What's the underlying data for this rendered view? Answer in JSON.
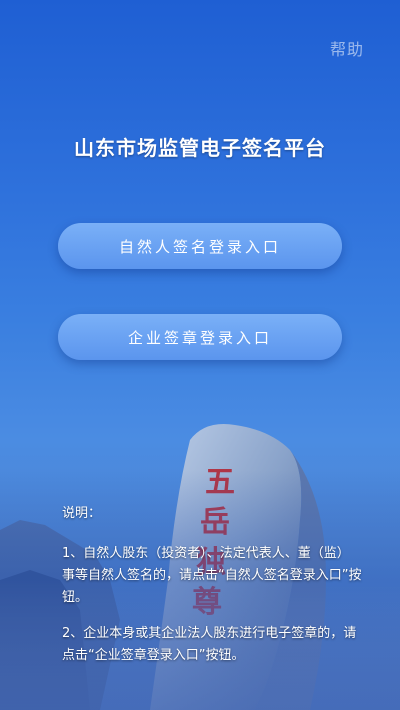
{
  "header": {
    "help_label": "帮助"
  },
  "main": {
    "title": "山东市场监管电子签名平台",
    "buttons": [
      {
        "label": "自然人签名登录入口"
      },
      {
        "label": "企业签章登录入口"
      }
    ]
  },
  "notes": {
    "heading": "说明：",
    "items": [
      "1、自然人股东（投资者）、法定代表人、董（监）事等自然人签名的，请点击“自然人签名登录入口”按钮。",
      "2、企业本身或其企业法人股东进行电子签章的，请点击“企业签章登录入口”按钮。"
    ]
  },
  "colors": {
    "background_top": "#1f5fd3",
    "background_bottom": "#3f6fbf",
    "button": "#6aa3f3",
    "text": "#ffffff"
  },
  "background_image": {
    "stone_inscription": "五岳独尊"
  }
}
